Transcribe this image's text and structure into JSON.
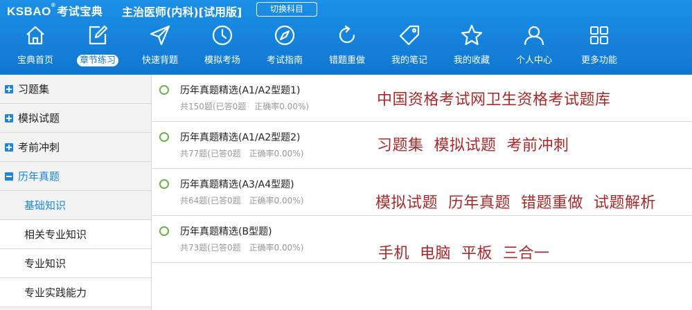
{
  "header": {
    "logo_latin": "KSBAO",
    "logo_reg": "®",
    "logo_cn": "考试宝典",
    "exam_title": "主治医师(内科)[试用版]",
    "switch_label": "切换科目"
  },
  "nav": [
    {
      "icon": "home-icon",
      "label": "宝典首页"
    },
    {
      "icon": "edit-icon",
      "label": "章节练习"
    },
    {
      "icon": "send-icon",
      "label": "快速背题"
    },
    {
      "icon": "clock-icon",
      "label": "模拟考场"
    },
    {
      "icon": "compass-icon",
      "label": "考试指南"
    },
    {
      "icon": "refresh-icon",
      "label": "错题重做"
    },
    {
      "icon": "tag-icon",
      "label": "我的笔记"
    },
    {
      "icon": "star-icon",
      "label": "我的收藏"
    },
    {
      "icon": "user-icon",
      "label": "个人中心"
    },
    {
      "icon": "grid-icon",
      "label": "更多功能"
    }
  ],
  "nav_active": "章节练习",
  "sidebar": {
    "groups": [
      {
        "label": "习题集"
      },
      {
        "label": "模拟试题"
      },
      {
        "label": "考前冲刺"
      },
      {
        "label": "历年真题"
      }
    ],
    "subitems": [
      {
        "label": "基础知识"
      },
      {
        "label": "相关专业知识"
      },
      {
        "label": "专业知识"
      },
      {
        "label": "专业实践能力"
      }
    ]
  },
  "list": [
    {
      "title": "历年真题精选(A1/A2型题1)",
      "count": "共150题(已答0题",
      "accuracy": "正确率0.00%)"
    },
    {
      "title": "历年真题精选(A1/A2型题2)",
      "count": "共77题(已答0题",
      "accuracy": "正确率0.00%)"
    },
    {
      "title": "历年真题精选(A3/A4型题)",
      "count": "共64题(已答0题",
      "accuracy": "正确率0.00%)"
    },
    {
      "title": "历年真题精选(B型题)",
      "count": "共73题(已答0题",
      "accuracy": "正确率0.00%)"
    }
  ],
  "promo": [
    "中国资格考试网卫生资格考试题库",
    "习题集  模拟试题  考前冲刺",
    "模拟试题  历年真题  错题重做  试题解析",
    "手机  电脑  平板  三合一"
  ],
  "colors": {
    "header_blue": "#1277cf",
    "accent_blue": "#1b86dc",
    "promo_red": "#a52a2a",
    "circle_green": "#6ab04c"
  }
}
